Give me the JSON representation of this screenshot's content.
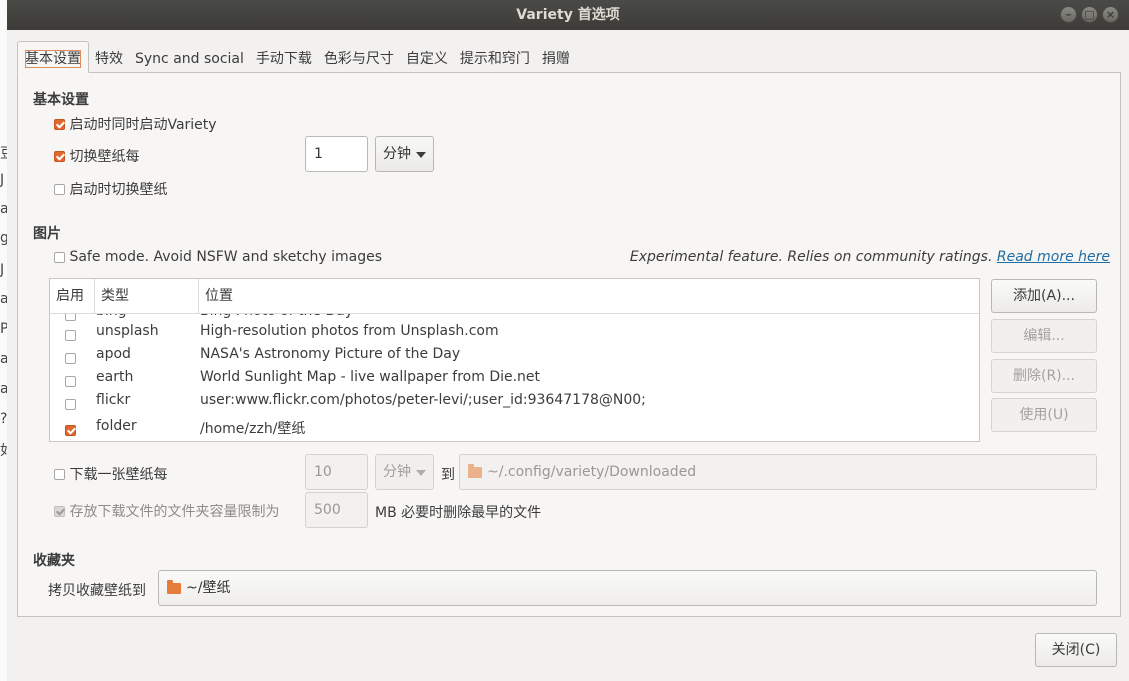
{
  "window": {
    "title": "Variety 首选项"
  },
  "background_window_chars": [
    "豆",
    "J",
    "a",
    "g",
    "J",
    "a",
    "P",
    "a",
    "a",
    "?",
    "如"
  ],
  "tabs": [
    "基本设置",
    "特效",
    "Sync and social",
    "手动下载",
    "色彩与尺寸",
    "自定义",
    "提示和窍门",
    "捐赠"
  ],
  "basic": {
    "section_title": "基本设置",
    "start_at_login": "启动时同时启动Variety",
    "change_every": "切换壁纸每",
    "change_interval_value": "1",
    "change_interval_unit": "分钟",
    "change_on_start": "启动时切换壁纸"
  },
  "images": {
    "section_title": "图片",
    "safe_mode": "Safe mode. Avoid NSFW and sketchy images",
    "experimental_note": "Experimental feature. Relies on community ratings.",
    "read_more": "Read more here",
    "columns": [
      "启用",
      "类型",
      "位置"
    ],
    "rows": [
      {
        "enabled": false,
        "type": "bing",
        "location": "Bing Photo of the Day"
      },
      {
        "enabled": false,
        "type": "unsplash",
        "location": "High-resolution photos from Unsplash.com"
      },
      {
        "enabled": false,
        "type": "apod",
        "location": "NASA's Astronomy Picture of the Day"
      },
      {
        "enabled": false,
        "type": "earth",
        "location": "World Sunlight Map - live wallpaper from Die.net"
      },
      {
        "enabled": false,
        "type": "flickr",
        "location": "user:www.flickr.com/photos/peter-levi/;user_id:93647178@N00;"
      },
      {
        "enabled": true,
        "type": "folder",
        "location": "/home/zzh/壁纸"
      }
    ],
    "buttons": {
      "add": "添加(A)...",
      "edit": "编辑...",
      "remove": "删除(R)...",
      "use": "使用(U)"
    }
  },
  "download": {
    "download_every": "下载一张壁纸每",
    "interval_value": "10",
    "interval_unit": "分钟",
    "to_label": "到",
    "path": "~/.config/variety/Downloaded",
    "limit_label": "存放下载文件的文件夹容量限制为",
    "limit_value": "500",
    "limit_suffix": "MB 必要时删除最早的文件"
  },
  "favorites": {
    "section_title": "收藏夹",
    "copy_label": "拷贝收藏壁纸到",
    "path": "~/壁纸"
  },
  "close_button": "关闭(C)",
  "colors": {
    "accent": "#e2672f",
    "link": "#1e6da3",
    "titlebar": "#3c3b37"
  }
}
